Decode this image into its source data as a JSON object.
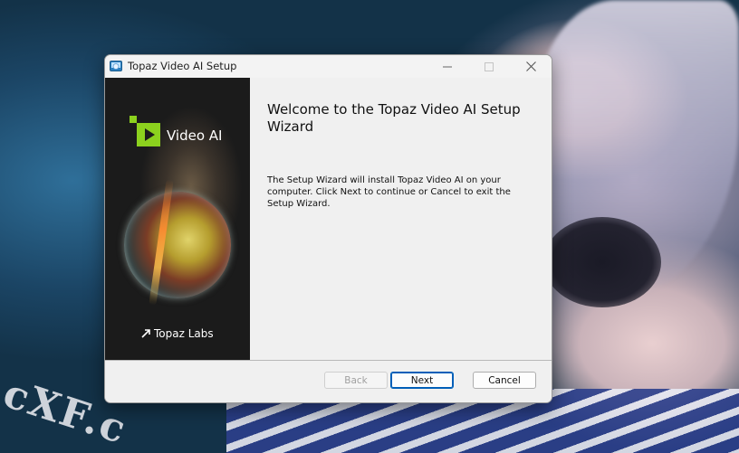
{
  "window": {
    "title": "Topaz Video AI Setup"
  },
  "sidebar": {
    "product_name": "Video AI",
    "brand_name": "Topaz Labs"
  },
  "content": {
    "heading": "Welcome to the Topaz Video AI Setup Wizard",
    "body": "The Setup Wizard will install Topaz Video AI on your computer. Click Next to continue or Cancel to exit the Setup Wizard."
  },
  "footer": {
    "back_label": "Back",
    "next_label": "Next",
    "cancel_label": "Cancel"
  },
  "colors": {
    "logo_green": "#8cd11e",
    "focus_blue": "#005fb8"
  }
}
